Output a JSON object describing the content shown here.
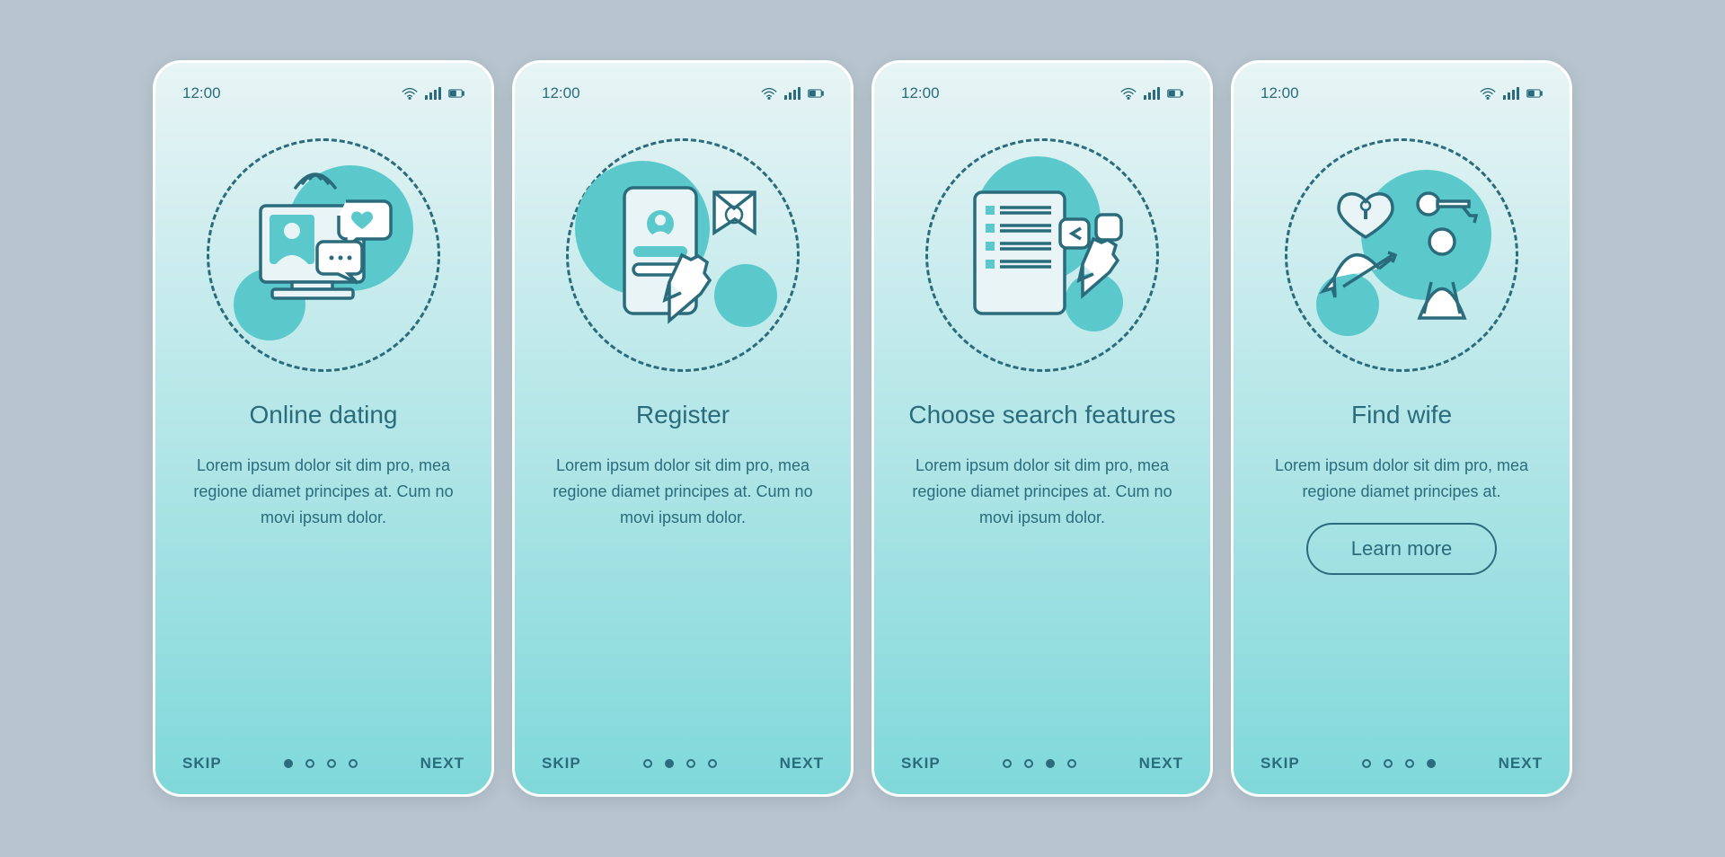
{
  "statusBar": {
    "time": "12:00"
  },
  "screens": [
    {
      "title": "Online dating",
      "description": "Lorem ipsum dolor sit dim pro, mea regione diamet principes at. Cum no movi ipsum dolor.",
      "activeIndex": 0
    },
    {
      "title": "Register",
      "description": "Lorem ipsum dolor sit dim pro, mea regione diamet principes at. Cum no movi ipsum dolor.",
      "activeIndex": 1
    },
    {
      "title": "Choose search features",
      "description": "Lorem ipsum dolor sit dim pro, mea regione diamet principes at. Cum no movi ipsum dolor.",
      "activeIndex": 2
    },
    {
      "title": "Find wife",
      "description": "Lorem ipsum dolor sit dim pro, mea regione diamet principes at.",
      "activeIndex": 3,
      "ctaLabel": "Learn more"
    }
  ],
  "nav": {
    "skip": "SKIP",
    "next": "NEXT"
  },
  "colors": {
    "primary": "#2a6b7c",
    "accent": "#5bc9cc",
    "gradientStart": "#e8f4f5",
    "gradientEnd": "#7fd8da"
  }
}
